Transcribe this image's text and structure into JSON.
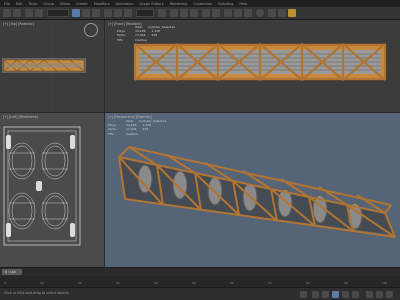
{
  "menu": {
    "items": [
      "File",
      "Edit",
      "Tools",
      "Group",
      "Views",
      "Create",
      "Modifiers",
      "Animation",
      "Graph Editors",
      "Rendering",
      "Customize",
      "Scripting",
      "Help"
    ]
  },
  "viewports": {
    "top_left": {
      "label": "[+] [Top] [Realistic]"
    },
    "top_right": {
      "label": "[+] [Front] [Realistic]",
      "stats": [
        {
          "k": "",
          "a": "Total",
          "b": "Cylinder_Selected"
        },
        {
          "k": "Polys:",
          "a": "34,186",
          "b": "1,128"
        },
        {
          "k": "Verts:",
          "a": "17,404",
          "b": "576"
        },
        {
          "k": "FPS:",
          "a": "Inactive",
          "b": ""
        }
      ]
    },
    "bottom_left": {
      "label": "[+] [Left] [Wireframe]"
    },
    "bottom_right": {
      "label": "[+] [Perspective] [Realistic]",
      "stats": [
        {
          "k": "",
          "a": "Total",
          "b": "Cylinder_Selected"
        },
        {
          "k": "Polys:",
          "a": "34,186",
          "b": "1,128"
        },
        {
          "k": "Verts:",
          "a": "17,404",
          "b": "576"
        },
        {
          "k": "FPS:",
          "a": "Inactive",
          "b": ""
        }
      ]
    }
  },
  "timeline": {
    "frame_label": "0 / 100",
    "ticks": [
      "0",
      "10",
      "20",
      "30",
      "40",
      "50",
      "60",
      "70",
      "80",
      "90",
      "100"
    ]
  },
  "status": {
    "text": "Click or click-and-drag to select objects"
  },
  "colors": {
    "perspective_bg": "#566478",
    "wood": "#c98a3e",
    "accent": "#5a7aa8"
  }
}
